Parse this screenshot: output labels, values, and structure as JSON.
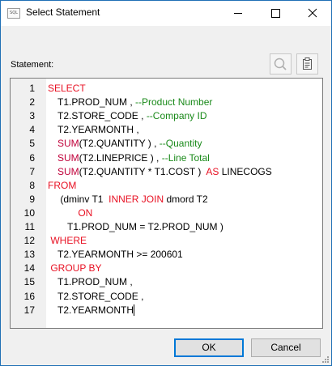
{
  "window": {
    "title": "Select Statement",
    "icon": "sql-icon",
    "icon_text": "SQL"
  },
  "statement": {
    "label": "Statement:",
    "tools": [
      "search-icon",
      "clipboard-icon"
    ],
    "lines": [
      {
        "n": "1",
        "indent": 0,
        "segs": [
          {
            "t": "SELECT",
            "c": "kw"
          }
        ]
      },
      {
        "n": "2",
        "indent": 1,
        "segs": [
          {
            "t": "T1.PROD_NUM , ",
            "c": ""
          },
          {
            "t": "--Product Number",
            "c": "cm"
          }
        ]
      },
      {
        "n": "3",
        "indent": 1,
        "segs": [
          {
            "t": "T2.STORE_CODE , ",
            "c": ""
          },
          {
            "t": "--Company ID",
            "c": "cm"
          }
        ]
      },
      {
        "n": "4",
        "indent": 1,
        "segs": [
          {
            "t": "T2.YEARMONTH ,",
            "c": ""
          }
        ]
      },
      {
        "n": "5",
        "indent": 1,
        "segs": [
          {
            "t": "SUM",
            "c": "fn"
          },
          {
            "t": "(T2.QUANTITY ) , ",
            "c": ""
          },
          {
            "t": "--Quantity",
            "c": "cm"
          }
        ]
      },
      {
        "n": "6",
        "indent": 1,
        "segs": [
          {
            "t": "SUM",
            "c": "fn"
          },
          {
            "t": "(T2.LINEPRICE ) , ",
            "c": ""
          },
          {
            "t": "--Line Total",
            "c": "cm"
          }
        ]
      },
      {
        "n": "7",
        "indent": 1,
        "segs": [
          {
            "t": "SUM",
            "c": "fn"
          },
          {
            "t": "(T2.QUANTITY * T1.COST )  ",
            "c": ""
          },
          {
            "t": "AS",
            "c": "kw"
          },
          {
            "t": " LINECOGS",
            "c": ""
          }
        ]
      },
      {
        "n": "8",
        "indent": 0,
        "segs": [
          {
            "t": "FROM",
            "c": "kw"
          }
        ]
      },
      {
        "n": "9",
        "indent": 1,
        "segs": [
          {
            "t": " (dminv T1  ",
            "c": ""
          },
          {
            "t": "INNER JOIN",
            "c": "kw"
          },
          {
            "t": " dmord T2",
            "c": ""
          }
        ]
      },
      {
        "n": "10",
        "indent": 2,
        "segs": [
          {
            "t": "    ON",
            "c": "kw"
          }
        ]
      },
      {
        "n": "11",
        "indent": 2,
        "segs": [
          {
            "t": "T1.PROD_NUM = T2.PROD_NUM )",
            "c": ""
          }
        ]
      },
      {
        "n": "12",
        "indent": 0,
        "segs": [
          {
            "t": " WHERE",
            "c": "kw"
          }
        ]
      },
      {
        "n": "13",
        "indent": 1,
        "segs": [
          {
            "t": "T2.YEARMONTH >= 200601",
            "c": ""
          }
        ]
      },
      {
        "n": "14",
        "indent": 0,
        "segs": [
          {
            "t": " GROUP BY",
            "c": "kw"
          }
        ]
      },
      {
        "n": "15",
        "indent": 1,
        "segs": [
          {
            "t": "T1.PROD_NUM ,",
            "c": ""
          }
        ]
      },
      {
        "n": "16",
        "indent": 1,
        "segs": [
          {
            "t": "T2.STORE_CODE ,",
            "c": ""
          }
        ]
      },
      {
        "n": "17",
        "indent": 1,
        "segs": [
          {
            "t": "T2.YEARMONTH",
            "c": ""
          }
        ]
      }
    ]
  },
  "buttons": {
    "ok": "OK",
    "cancel": "Cancel"
  },
  "colors": {
    "keyword": "#e81123",
    "function": "#c0003a",
    "comment": "#1a8a1a",
    "accent": "#0078d7"
  }
}
